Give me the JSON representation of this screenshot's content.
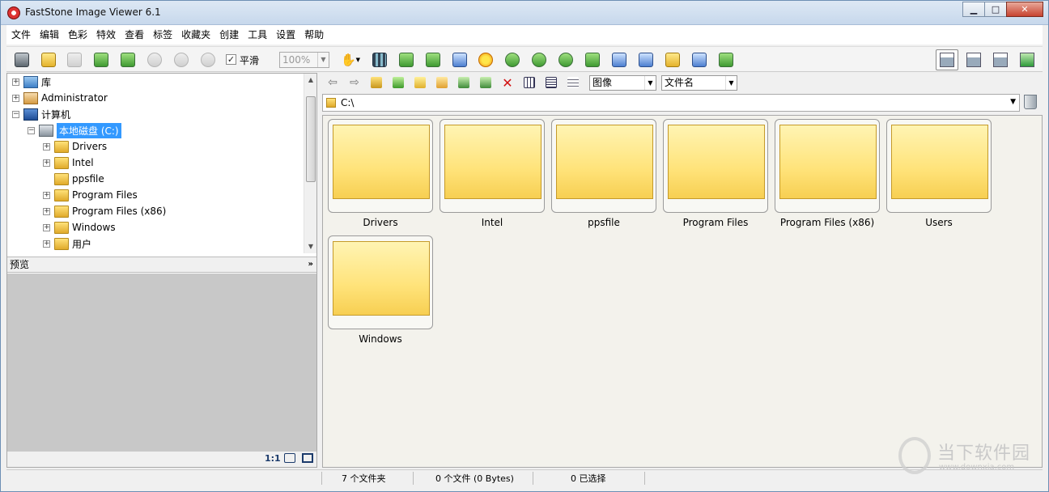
{
  "window": {
    "title": "FastStone Image Viewer 6.1"
  },
  "window_controls": {
    "minimize": "▁",
    "maximize": "□",
    "close": "✕"
  },
  "menu": [
    "文件",
    "编辑",
    "色彩",
    "特效",
    "查看",
    "标签",
    "收藏夹",
    "创建",
    "工具",
    "设置",
    "帮助"
  ],
  "toolbar": {
    "smooth_checked": "✓",
    "smooth_label": "平滑",
    "zoom_value": "100%"
  },
  "tree": {
    "items": [
      {
        "label": "库",
        "icon": "library-icon",
        "expander": "+"
      },
      {
        "label": "Administrator",
        "icon": "user-folder-icon",
        "expander": "+"
      },
      {
        "label": "计算机",
        "icon": "computer-icon",
        "expander": "−"
      },
      {
        "label": "本地磁盘 (C:)",
        "icon": "drive-icon",
        "expander": "−",
        "selected": true
      },
      {
        "label": "Drivers",
        "icon": "folder-icon",
        "expander": "+"
      },
      {
        "label": "Intel",
        "icon": "folder-icon",
        "expander": "+"
      },
      {
        "label": "ppsfile",
        "icon": "folder-icon",
        "expander": ""
      },
      {
        "label": "Program Files",
        "icon": "folder-icon",
        "expander": "+"
      },
      {
        "label": "Program Files (x86)",
        "icon": "folder-icon",
        "expander": "+"
      },
      {
        "label": "Windows",
        "icon": "folder-icon",
        "expander": "+"
      },
      {
        "label": "用户",
        "icon": "folder-icon",
        "expander": "+"
      }
    ]
  },
  "preview": {
    "title": "预览",
    "toggle": "»",
    "actual_size": "1:1"
  },
  "browser": {
    "filter_value": "图像",
    "sort_value": "文件名",
    "path": "C:\\",
    "thumbnails": [
      "Drivers",
      "Intel",
      "ppsfile",
      "Program Files",
      "Program Files (x86)",
      "Users",
      "Windows"
    ]
  },
  "status": {
    "folders": "7 个文件夹",
    "files": "0 个文件 (0 Bytes)",
    "selected": "0 已选择"
  },
  "watermark": {
    "text": "当下软件园",
    "url": "www.downxia.com"
  }
}
